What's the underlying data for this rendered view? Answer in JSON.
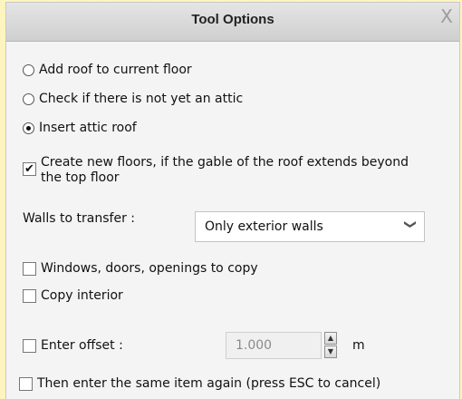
{
  "window": {
    "title": "Tool Options",
    "close_icon": "X"
  },
  "options": {
    "radios": [
      {
        "label": "Add roof to current floor",
        "selected": false
      },
      {
        "label": "Check if there is not yet an attic",
        "selected": false
      },
      {
        "label": "Insert attic roof",
        "selected": true
      }
    ],
    "create_floors": {
      "label": "Create new floors, if the gable of the roof extends beyond the top floor",
      "checked": true
    },
    "walls_to_transfer": {
      "label": "Walls to transfer :",
      "value": "Only exterior walls"
    },
    "windows_copy": {
      "label": "Windows, doors, openings to copy",
      "checked": false
    },
    "copy_interior": {
      "label": "Copy interior",
      "checked": false
    },
    "enter_offset": {
      "label": "Enter offset :",
      "checked": false,
      "value": "1.000",
      "unit": "m"
    },
    "repeat": {
      "label": "Then enter the same item again (press ESC to cancel)",
      "checked": false
    }
  },
  "glyphs": {
    "check": "✔",
    "chevron": "❯",
    "spin_up": "▲",
    "spin_down": "▼"
  }
}
